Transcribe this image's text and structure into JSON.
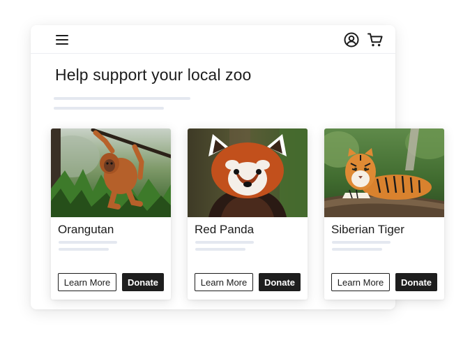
{
  "header": {
    "menu_icon": "hamburger-menu-icon",
    "account_icon": "user-circle-icon",
    "cart_icon": "shopping-cart-icon"
  },
  "main": {
    "title": "Help support your local zoo"
  },
  "cards": [
    {
      "name": "Orangutan",
      "image": "orangutan-photo",
      "learn_label": "Learn More",
      "donate_label": "Donate"
    },
    {
      "name": "Red Panda",
      "image": "red-panda-photo",
      "learn_label": "Learn More",
      "donate_label": "Donate"
    },
    {
      "name": "Siberian Tiger",
      "image": "siberian-tiger-photo",
      "learn_label": "Learn More",
      "donate_label": "Donate"
    }
  ],
  "colors": {
    "text": "#1c1c1c",
    "donate_button": "#1e1e1e",
    "skeleton": "#e4e8f0"
  }
}
